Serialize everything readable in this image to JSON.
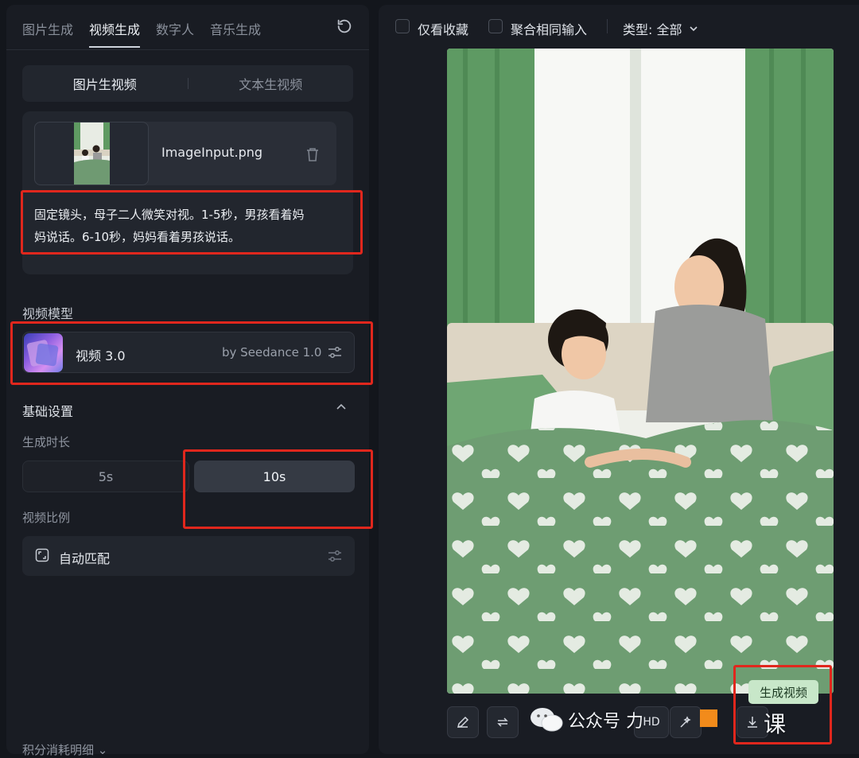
{
  "tabs": [
    "图片生成",
    "视频生成",
    "数字人",
    "音乐生成"
  ],
  "active_tab": "视频生成",
  "mode_switch": {
    "left": "图片生视频",
    "right": "文本生视频"
  },
  "upload": {
    "filename": "ImageInput.png"
  },
  "prompt": {
    "line1": "固定镜头，母子二人微笑对视。1-5秒，男孩看着妈",
    "line2": "妈说话。6-10秒，妈妈看着男孩说话。"
  },
  "model_section": {
    "title": "视频模型",
    "name": "视频 3.0",
    "by": "by Seedance 1.0"
  },
  "basic_settings": {
    "title": "基础设置",
    "duration_label": "生成时长",
    "durations": [
      "5s",
      "10s"
    ],
    "selected_duration": "10s",
    "ratio_label": "视频比例",
    "ratio_value": "自动匹配"
  },
  "credits_label": "积分消耗明细",
  "filters": {
    "favorites": "仅看收藏",
    "aggregate": "聚合相同输入",
    "type": "类型: 全部"
  },
  "result": {
    "tag": "生成视频",
    "hd_label": "HD"
  },
  "watermark": {
    "text": "公众号 力",
    "brand": "课"
  },
  "icons": [
    "refresh-icon",
    "trash-icon",
    "settings-sliders-icon",
    "chevron-up-icon",
    "chevron-down-icon",
    "ratio-icon",
    "pencil-icon",
    "repeat-icon",
    "wechat-icon"
  ],
  "colors": {
    "background": "#13161c",
    "panel": "#191c23",
    "highlight": "#e0271d",
    "tag": "#c8e7c9"
  }
}
